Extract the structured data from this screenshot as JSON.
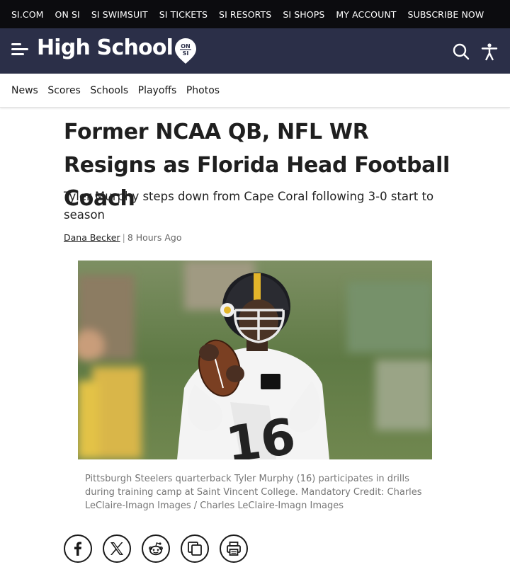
{
  "topnav": {
    "items": [
      "SI.COM",
      "ON SI",
      "SI SWIMSUIT",
      "SI TICKETS",
      "SI RESORTS",
      "SI SHOPS",
      "MY ACCOUNT",
      "SUBSCRIBE NOW"
    ]
  },
  "header": {
    "brand": "High School",
    "badge_top": "ON",
    "badge_bottom": "SI"
  },
  "nav": {
    "items": [
      "News",
      "Scores",
      "Schools",
      "Playoffs",
      "Photos"
    ]
  },
  "article": {
    "headline": "Former NCAA QB, NFL WR Resigns as Florida Head Football Coach",
    "subheadline": "Tyler Murphy steps down from Cape Coral following 3-0 start to season",
    "author": "Dana Becker",
    "separator": "|",
    "timestamp": "8 Hours Ago",
    "image_caption": "Pittsburgh Steelers quarterback Tyler Murphy (16) participates in drills during training camp at Saint Vincent College. Mandatory Credit: Charles LeClaire-Imagn Images / Charles LeClaire-Imagn Images"
  },
  "share": {
    "icons": [
      "facebook-icon",
      "x-icon",
      "reddit-icon",
      "copy-link-icon",
      "print-icon"
    ]
  },
  "colors": {
    "topbar": "#0c0c0f",
    "brandbar": "#2b2f48",
    "text": "#1f1f1f"
  }
}
